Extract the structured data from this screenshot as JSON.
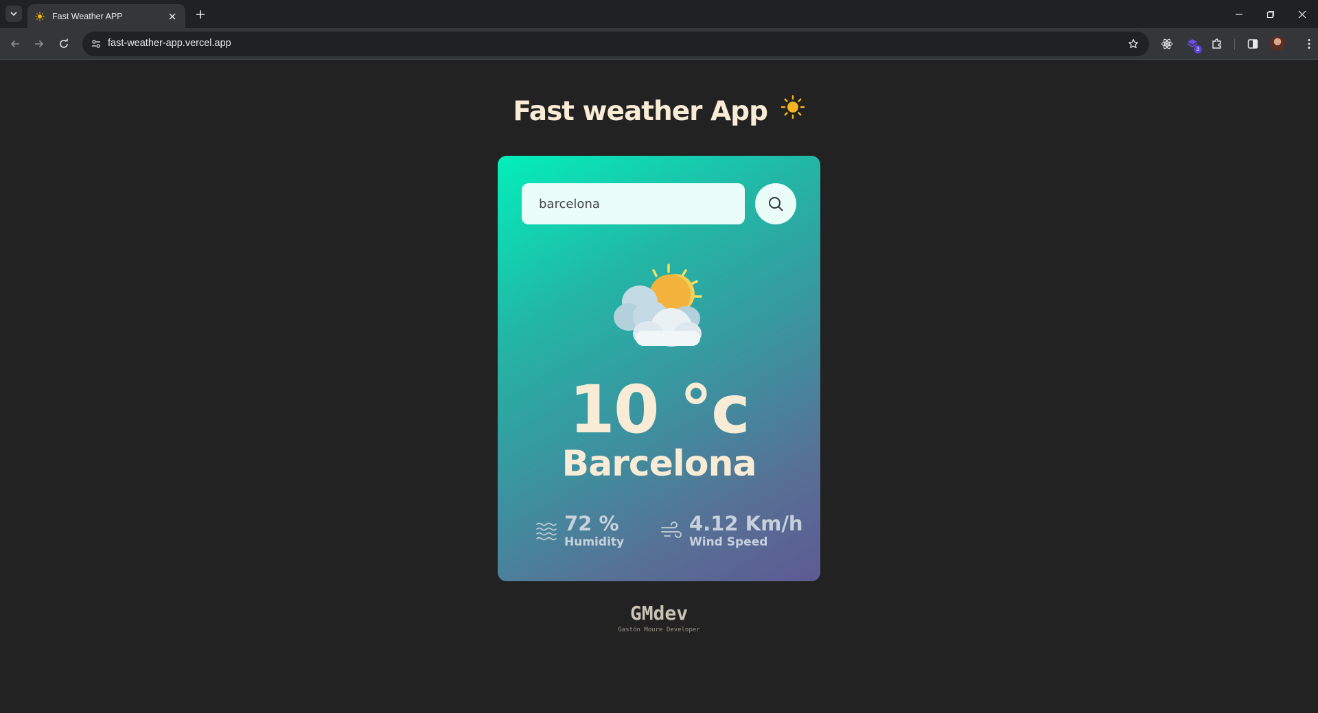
{
  "browser": {
    "tab_title": "Fast Weather APP",
    "url": "fast-weather-app.vercel.app",
    "extension_badge": "3"
  },
  "app": {
    "title": "Fast weather App",
    "search": {
      "value": "barcelona",
      "placeholder": ""
    },
    "weather_icon": "sun-behind-clouds-icon",
    "temperature": "10 °c",
    "city": "Barcelona",
    "humidity": {
      "value": "72 %",
      "label": "Humidity"
    },
    "wind": {
      "value": "4.12 Km/h",
      "label": "Wind Speed"
    }
  },
  "footer": {
    "logo": "GMdev",
    "subtitle": "Gastón Moure Developer"
  },
  "colors": {
    "page_background": "#222222",
    "title_text": "#f8ecd6",
    "card_gradient_start": "#03efbb",
    "card_gradient_end": "#5d5a93",
    "metric_text": "#c6d1dc"
  }
}
